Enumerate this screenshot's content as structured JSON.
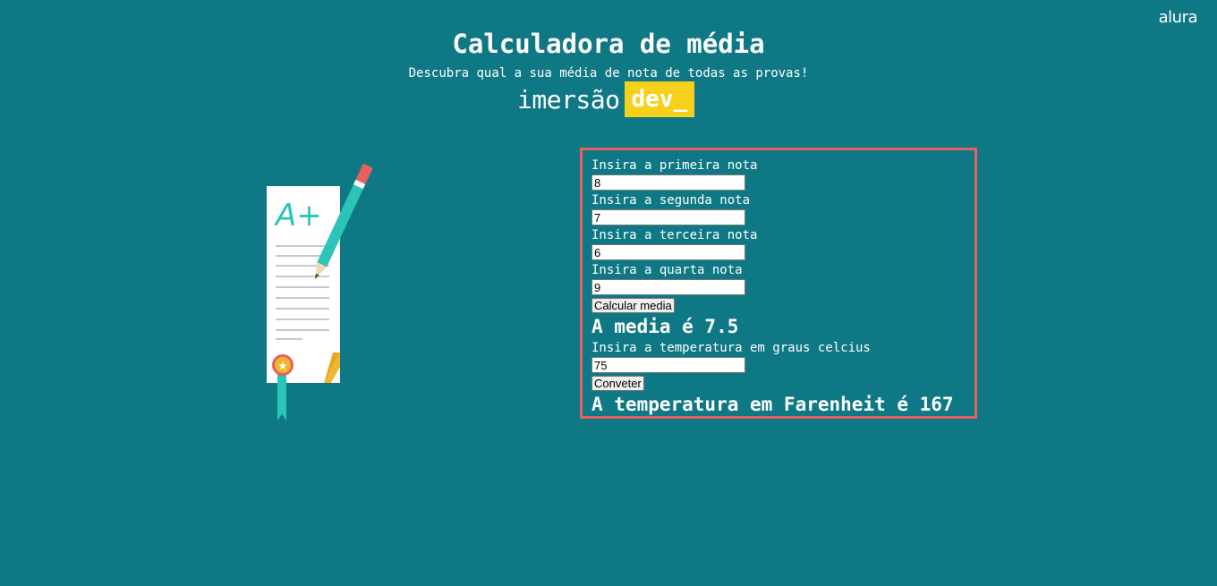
{
  "logo": {
    "text": "alura"
  },
  "header": {
    "title": "Calculadora de média",
    "subtitle": "Descubra qual a sua média de nota de todas as provas!",
    "brand_word": "imersão",
    "brand_badge": "dev_"
  },
  "illustration": {
    "icon": "graded-paper-with-pencil-icon",
    "grade_text": "A+"
  },
  "form": {
    "fields": [
      {
        "label": "Insira a primeira nota",
        "value": "8"
      },
      {
        "label": "Insira a segunda nota",
        "value": "7"
      },
      {
        "label": "Insira a terceira nota",
        "value": "6"
      },
      {
        "label": "Insira a quarta nota",
        "value": "9"
      }
    ],
    "calc_button": "Calcular media",
    "average_result": "A media é 7.5",
    "temperature_label": "Insira a temperatura em graus celcius",
    "temperature_value": "75",
    "convert_button": "Conveter",
    "temperature_result": "A temperatura em Farenheit é 167"
  },
  "colors": {
    "background": "#0f7885",
    "box_border": "#e8605b",
    "badge": "#f6d01b"
  }
}
